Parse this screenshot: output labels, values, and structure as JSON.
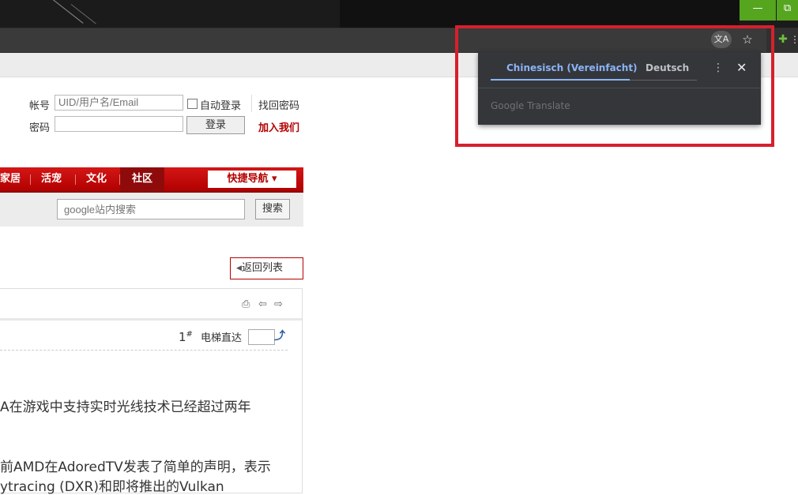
{
  "window": {
    "minimize_glyph": "—",
    "restore_glyph": "⧉"
  },
  "toolbar": {
    "translate_icon": "translate-icon",
    "star_icon": "star-icon",
    "extension_icon": "puzzle-icon"
  },
  "login": {
    "account_label": "帐号",
    "account_placeholder": "UID/用户名/Email",
    "auto_login_label": "自动登录",
    "find_password": "找回密码",
    "password_label": "密码",
    "login_button": "登录",
    "join_link": "加入我们"
  },
  "nav": {
    "items": [
      {
        "label": "家居"
      },
      {
        "label": "活宠"
      },
      {
        "label": "文化"
      },
      {
        "label": "社区"
      }
    ],
    "quick_nav": "快捷导航 ▾"
  },
  "search": {
    "placeholder": "google站内搜索",
    "button": "搜索"
  },
  "thread": {
    "back_button": "返回列表",
    "post_number": "1",
    "post_number_sup": "#",
    "elevator_label": "电梯直达",
    "paragraphs": [
      "A在游戏中支持实时光线技术已经超过两年",
      "前AMD在AdoredTV发表了简单的声明，表示",
      "ytracing (DXR)和即将推出的Vulkan"
    ]
  },
  "translate_popup": {
    "tab_source": "Chinesisch (Vereinfacht)",
    "tab_target": "Deutsch",
    "brand": "Google Translate",
    "accent_color": "#8ab4f8"
  },
  "colors": {
    "brand_red": "#b40000",
    "highlight_red": "#d6202d",
    "chrome_green": "#55a51f"
  }
}
